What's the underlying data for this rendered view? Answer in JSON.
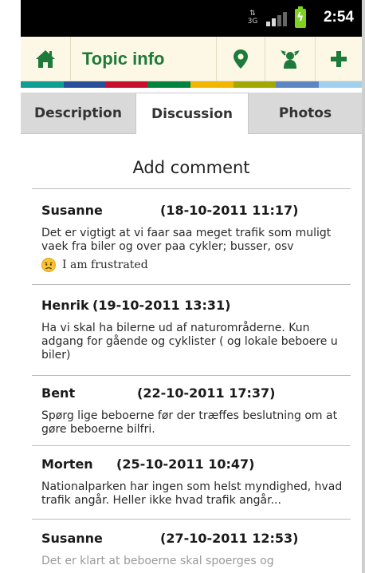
{
  "status_bar": {
    "network": "3G",
    "time": "2:54",
    "colors": {
      "battery": "#7ed321",
      "background": "#000000"
    }
  },
  "action_bar": {
    "title": "Topic info",
    "icons": [
      "home-icon",
      "map-pin-icon",
      "share-people-icon",
      "add-icon"
    ],
    "colors": {
      "icon": "#1e7a3a",
      "background": "#fdf7e6"
    },
    "color_strip": [
      "#0e9e93",
      "#2a4f9a",
      "#c8102e",
      "#00843d",
      "#f2b600",
      "#a3a800",
      "#5b87c5",
      "#9fd1ef"
    ]
  },
  "tabs": [
    {
      "label": "Description",
      "active": false
    },
    {
      "label": "Discussion",
      "active": true
    },
    {
      "label": "Photos",
      "active": false
    }
  ],
  "discussion": {
    "add_comment_label": "Add comment",
    "comments": [
      {
        "author": "Susanne",
        "date": "(18-10-2011 11:17)",
        "text": "Det er vigtigt at vi faar saa meget trafik som muligt vaek fra biler og over paa cykler; busser, osv",
        "mood": "I am frustrated",
        "mood_icon": "frustrated-face-icon"
      },
      {
        "author": "Henrik",
        "date": "(19-10-2011 13:31)",
        "text": "Ha vi skal ha bilerne ud af naturområderne. Kun adgang for gående og cyklister ( og lokale beboere u biler)"
      },
      {
        "author": "Bent",
        "date": "(22-10-2011 17:37)",
        "text": "Spørg lige beboerne før der træffes beslutning om at gøre beboerne bilfri."
      },
      {
        "author": "Morten",
        "date": "(25-10-2011 10:47)",
        "text": "Nationalparken har ingen som helst myndighed, hvad trafik angår. Heller ikke hvad trafik angår..."
      },
      {
        "author": "Susanne",
        "date": "(27-10-2011 12:53)",
        "text": "Det er klart at beboerne skal spoerges og"
      }
    ]
  }
}
